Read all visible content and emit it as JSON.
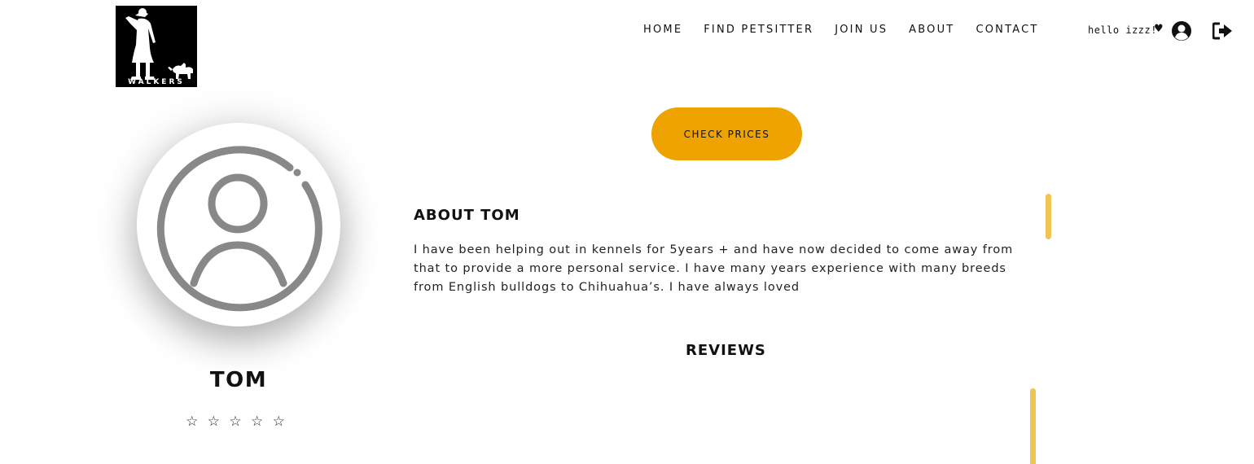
{
  "logo": {
    "text": "WALKERS",
    "icon": "walker-with-dog-icon"
  },
  "nav": {
    "items": [
      {
        "label": "HOME"
      },
      {
        "label": "FIND PETSITTER"
      },
      {
        "label": "JOIN US"
      },
      {
        "label": "ABOUT"
      },
      {
        "label": "CONTACT"
      }
    ],
    "greeting": "hello izzz!",
    "heart": "♥",
    "user_icon": "user-circle-icon",
    "logout_icon": "sign-out-icon"
  },
  "profile": {
    "avatar_icon": "user-avatar-icon",
    "name": "TOM",
    "stars": "☆ ☆ ☆ ☆ ☆",
    "rating": 0
  },
  "actions": {
    "check_prices_label": "CHECK PRICES"
  },
  "about": {
    "heading": "ABOUT TOM",
    "text": "I have been helping out in kennels for 5years + and have now decided to come away from that to provide a more personal service. I have many years experience with many breeds from English bulldogs to Chihuahua’s. I have always loved"
  },
  "reviews": {
    "heading": "REVIEWS"
  },
  "colors": {
    "accent": "#eea300",
    "scrollbar": "#f1c456",
    "avatar_stroke": "#888888"
  }
}
